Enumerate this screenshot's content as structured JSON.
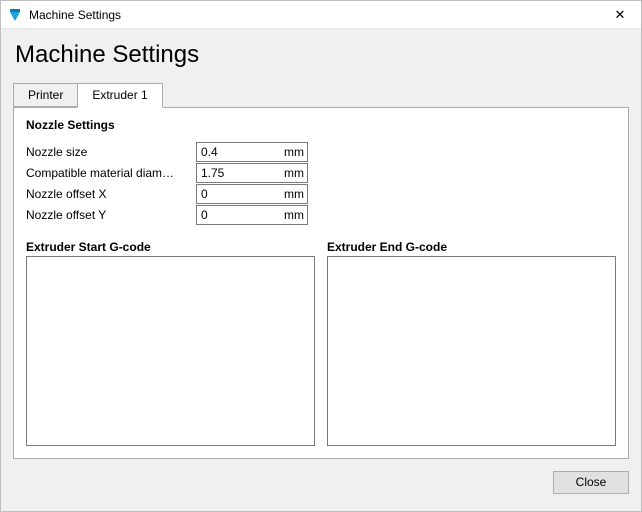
{
  "window": {
    "title": "Machine Settings",
    "close_icon": "✕"
  },
  "page": {
    "heading": "Machine Settings"
  },
  "tabs": {
    "printer": "Printer",
    "extruder1": "Extruder 1"
  },
  "nozzle_settings": {
    "section_title": "Nozzle Settings",
    "fields": {
      "nozzle_size": {
        "label": "Nozzle size",
        "value": "0.4",
        "unit": "mm"
      },
      "material_diameter": {
        "label": "Compatible material diam…",
        "value": "1.75",
        "unit": "mm"
      },
      "offset_x": {
        "label": "Nozzle offset X",
        "value": "0",
        "unit": "mm"
      },
      "offset_y": {
        "label": "Nozzle offset Y",
        "value": "0",
        "unit": "mm"
      }
    }
  },
  "gcode": {
    "start_label": "Extruder Start G-code",
    "end_label": "Extruder End G-code",
    "start_value": "",
    "end_value": ""
  },
  "footer": {
    "close_label": "Close"
  }
}
